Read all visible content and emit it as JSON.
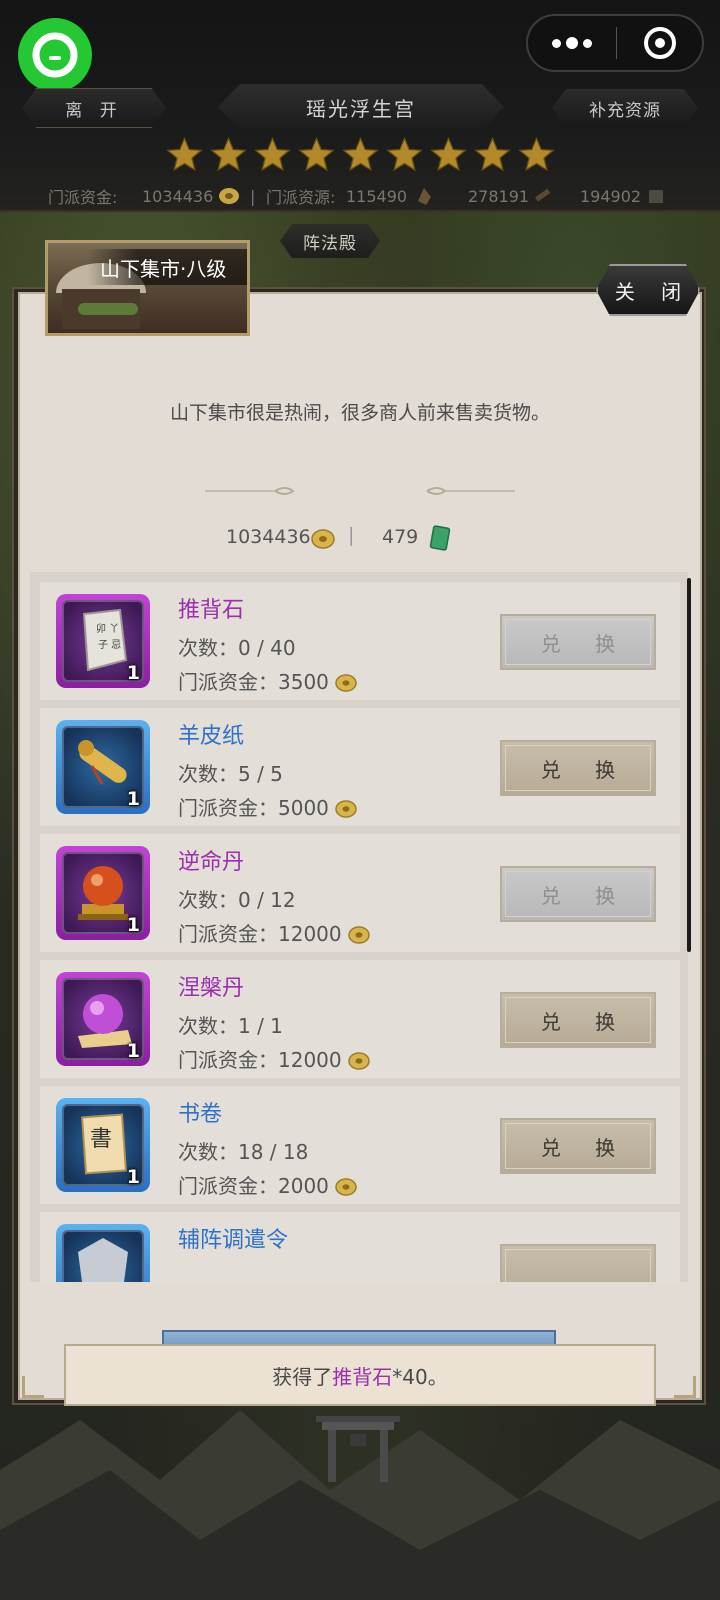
{
  "header": {
    "leave_label": "离 开",
    "title": "瑶光浮生宫",
    "supply_label": "补充资源",
    "star_count": 9,
    "resources": {
      "fund_label": "门派资金:",
      "fund_value": "1034436",
      "divider": "|",
      "res_label": "门派资源:",
      "res_value": "115490",
      "wood_value": "278191",
      "stone_value": "194902"
    }
  },
  "hall_tab": "阵法殿",
  "dialog": {
    "market_title": "山下集市·八级",
    "close_label": "关 闭",
    "description": "山下集市很是热闹，很多商人前来售卖货物。",
    "currency": {
      "coins": "1034436",
      "divider": "|",
      "jade": "479"
    },
    "items": [
      {
        "name": "推背石",
        "rarity": "purple",
        "icon": "scroll-stone-icon",
        "qty": "1",
        "count": "次数：0 / 40",
        "cost": "门派资金：3500",
        "button": "兑 换",
        "enabled": false
      },
      {
        "name": "羊皮纸",
        "rarity": "blue",
        "icon": "parchment-scroll-icon",
        "qty": "1",
        "count": "次数：5 / 5",
        "cost": "门派资金：5000",
        "button": "兑 换",
        "enabled": true
      },
      {
        "name": "逆命丹",
        "rarity": "purple",
        "icon": "red-orb-icon",
        "qty": "1",
        "count": "次数：0 / 12",
        "cost": "门派资金：12000",
        "button": "兑 换",
        "enabled": false
      },
      {
        "name": "涅槃丹",
        "rarity": "purple",
        "icon": "purple-orb-icon",
        "qty": "1",
        "count": "次数：1 / 1",
        "cost": "门派资金：12000",
        "button": "兑 换",
        "enabled": true
      },
      {
        "name": "书卷",
        "rarity": "blue",
        "icon": "book-icon",
        "qty": "1",
        "count": "次数：18 / 18",
        "cost": "门派资金：2000",
        "button": "兑 换",
        "enabled": true
      },
      {
        "name": "辅阵调遣令",
        "rarity": "blue",
        "icon": "token-icon",
        "qty": "",
        "count": "",
        "cost": "",
        "button": "",
        "enabled": true
      }
    ]
  },
  "toast": {
    "prefix": "获得了",
    "item": "推背石",
    "suffix": "*40。"
  },
  "colors": {
    "purple": "#9b2fae",
    "blue": "#2d72c8",
    "brand_green": "#24c832"
  }
}
